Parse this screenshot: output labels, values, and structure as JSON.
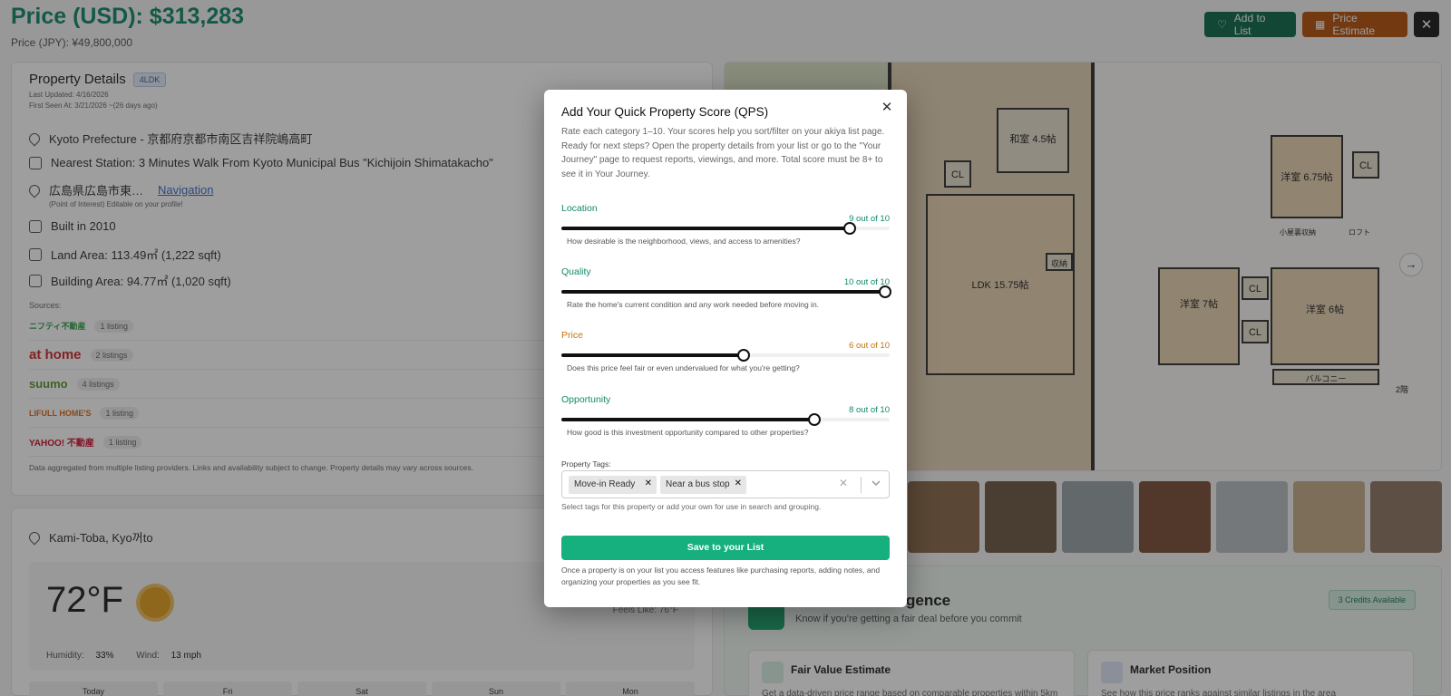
{
  "header": {
    "price_usd": "Price (USD): $313,283",
    "price_jpy": "Price (JPY): ¥49,800,000",
    "add_to_list": "Add to List",
    "price_estimate": "Price Estimate",
    "close": "✕"
  },
  "details": {
    "title": "Property Details",
    "layout_badge": "4LDK",
    "last_updated": "Last Updated: 4/16/2026",
    "first_seen": "First Seen At: 3/21/2026 ~(26 days ago)",
    "prefecture": "Kyoto Prefecture - 京都府京都市南区吉祥院嶋高町",
    "station": "Nearest Station: 3 Minutes Walk From Kyoto Municipal Bus \"Kichijoin Shimatakacho\"",
    "poi": "広島県広島市東…",
    "navigation": "Navigation",
    "poi_note": "(Point of Interest) Editable on your profile!",
    "built": "Built in 2010",
    "land_area": "Land Area: 113.49㎡ (1,222 sqft)",
    "building_area": "Building Area: 94.77㎡ (1,020 sqft)",
    "sources_label": "Sources:",
    "sources": [
      {
        "name": "ニフティ不動産",
        "count": "1 listing",
        "color": "#2f9d4c"
      },
      {
        "name": "at home",
        "count": "2 listings",
        "color": "#d12a2a"
      },
      {
        "name": "suumo",
        "count": "4 listings",
        "color": "#5a9a2a"
      },
      {
        "name": "LIFULL HOME'S",
        "count": "1 listing",
        "color": "#e06a1a"
      },
      {
        "name": "YAHOO! 不動産",
        "count": "1 listing",
        "color": "#d01030"
      }
    ],
    "aggregation_note": "Data aggregated from multiple listing providers. Links and availability subject to change. Property details may vary across sources."
  },
  "weather": {
    "location": "Kami-Toba, Kyo꺼to",
    "temperature": "72°F",
    "feels_like": "Feels Like: 76°F",
    "humidity_label": "Humidity:",
    "humidity": "33%",
    "wind_label": "Wind:",
    "wind": "13 mph",
    "days": [
      "Today",
      "Fri",
      "Sat",
      "Sun",
      "Mon"
    ]
  },
  "floorplan": {
    "rooms": [
      "和室 4.5帖",
      "CL",
      "LDK 15.75帖",
      "収納",
      "洋室 6.75帖",
      "CL",
      "洋室 7帖",
      "CL",
      "洋室 6帖",
      "CL",
      "バルコニー",
      "2階",
      "小屋裏収納",
      "ロフト"
    ]
  },
  "intelligence": {
    "title": "gence",
    "subtitle": "Know if you're getting a fair deal before you commit",
    "credits": "3 Credits Available",
    "fair_value_title": "Fair Value Estimate",
    "fair_value_text": "Get a data-driven price range based on comparable properties within 5km",
    "market_title": "Market Position",
    "market_text": "See how this price ranks against similar listings in the area"
  },
  "modal": {
    "title": "Add Your Quick Property Score (QPS)",
    "description": "Rate each category 1–10. Your scores help you sort/filter on your akiya list page. Ready for next steps? Open the property details from your list or go to the \"Your Journey\" page to request reports, viewings, and more. Total score must be 8+ to see it in Your Journey.",
    "categories": [
      {
        "label": "Location",
        "score": "9 out of 10",
        "value": 9,
        "help": "How desirable is the neighborhood, views, and access to amenities?",
        "color": "#10896a"
      },
      {
        "label": "Quality",
        "score": "10 out of 10",
        "value": 10,
        "help": "Rate the home's current condition and any work needed before moving in.",
        "color": "#10896a"
      },
      {
        "label": "Price",
        "score": "6 out of 10",
        "value": 6,
        "help": "Does this price feel fair or even undervalued for what you're getting?",
        "color": "#c07511"
      },
      {
        "label": "Opportunity",
        "score": "8 out of 10",
        "value": 8,
        "help": "How good is this investment opportunity compared to other properties?",
        "color": "#10896a"
      }
    ],
    "tags_label": "Property Tags:",
    "tags": [
      "Move-in Ready",
      "Near a bus stop"
    ],
    "tags_hint": "Select tags for this property or add your own for use in search and grouping.",
    "save_button": "Save to your List",
    "save_note": "Once a property is on your list you access features like purchasing reports, adding notes, and organizing your properties as you see fit."
  }
}
